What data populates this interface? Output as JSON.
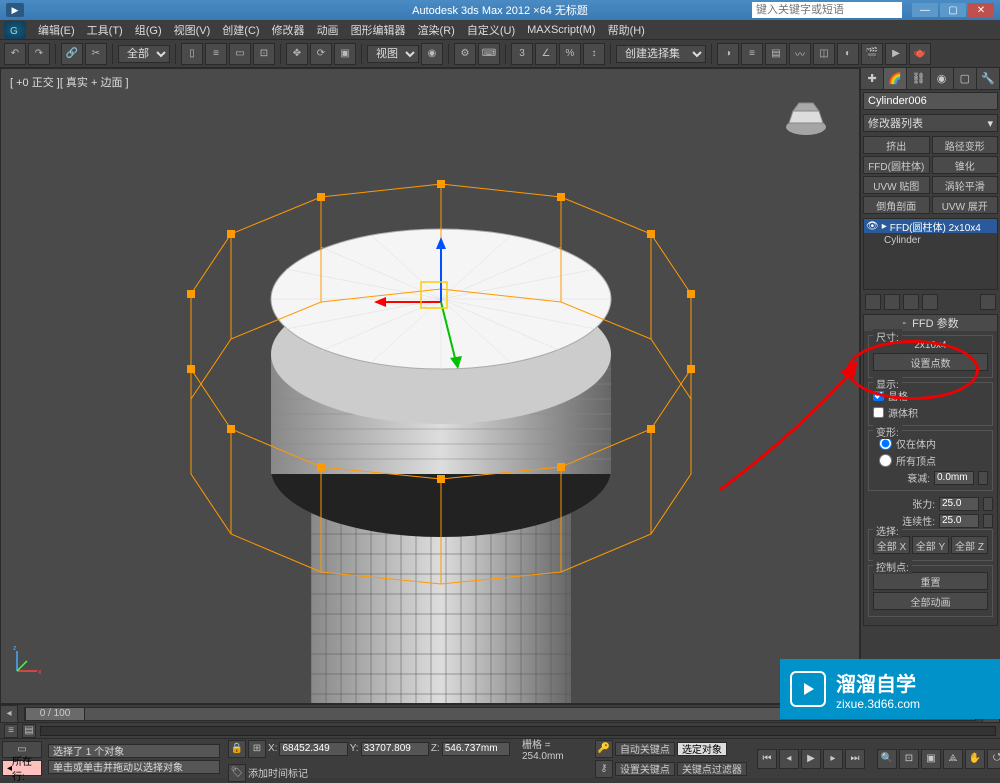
{
  "app": {
    "title": "Autodesk 3ds Max 2012 ×64   无标题",
    "search_placeholder": "键入关键字或短语"
  },
  "menu": [
    "编辑(E)",
    "工具(T)",
    "组(G)",
    "视图(V)",
    "创建(C)",
    "修改器",
    "动画",
    "图形编辑器",
    "渲染(R)",
    "自定义(U)",
    "MAXScript(M)",
    "帮助(H)"
  ],
  "toolbar": {
    "selection_filter": "全部",
    "view_label": "视图",
    "named_set": "创建选择集"
  },
  "viewport": {
    "label": "[ +0 正交 ][ 真实 + 边面 ]"
  },
  "cmdpanel": {
    "object_name": "Cylinder006",
    "modifier_list_label": "修改器列表",
    "mod_buttons": [
      "挤出",
      "路径变形",
      "FFD(圆柱体)",
      "锥化",
      "UVW 贴图",
      "涡轮平滑",
      "倒角剖面",
      "UVW 展开"
    ],
    "modstack": [
      {
        "icon": "⊕",
        "label": "FFD(圆柱体) 2x10x4",
        "sel": true
      },
      {
        "icon": "",
        "label": "Cylinder",
        "sel": false
      }
    ],
    "ffd": {
      "rollout_title": "FFD 参数",
      "dim_group": "尺寸:",
      "dimensions": "2x10x4",
      "set_points_btn": "设置点数",
      "display_group": "显示:",
      "lattice_chk": "晶格",
      "lattice_checked": true,
      "source_chk": "源体积",
      "source_checked": false,
      "deform_group": "变形:",
      "in_volume": "仅在体内",
      "all_verts": "所有顶点",
      "falloff_label": "衰减:",
      "falloff_value": "0.0mm",
      "tension_label": "张力:",
      "tension_value": "25.0",
      "continuity_label": "连续性:",
      "continuity_value": "25.0",
      "select_group": "选择:",
      "all_x": "全部 X",
      "all_y": "全部 Y",
      "all_z": "全部 Z",
      "ctrl_group": "控制点:",
      "reset": "重置",
      "animate_all": "全部动画"
    }
  },
  "timeline": {
    "frame": "0 / 100"
  },
  "status": {
    "tag": "所在行:",
    "prompt1": "选择了 1 个对象",
    "prompt2": "单击或单击并拖动以选择对象",
    "add_time_tag": "添加时间标记",
    "x": "68452.349",
    "y": "33707.809",
    "z": "546.737mm",
    "grid": "栅格 = 254.0mm",
    "autokey": "自动关键点",
    "selected": "选定对象",
    "setkey": "设置关键点",
    "keyfilter": "关键点过滤器"
  },
  "watermark": {
    "cn": "溜溜自学",
    "en": "zixue.3d66.com"
  }
}
